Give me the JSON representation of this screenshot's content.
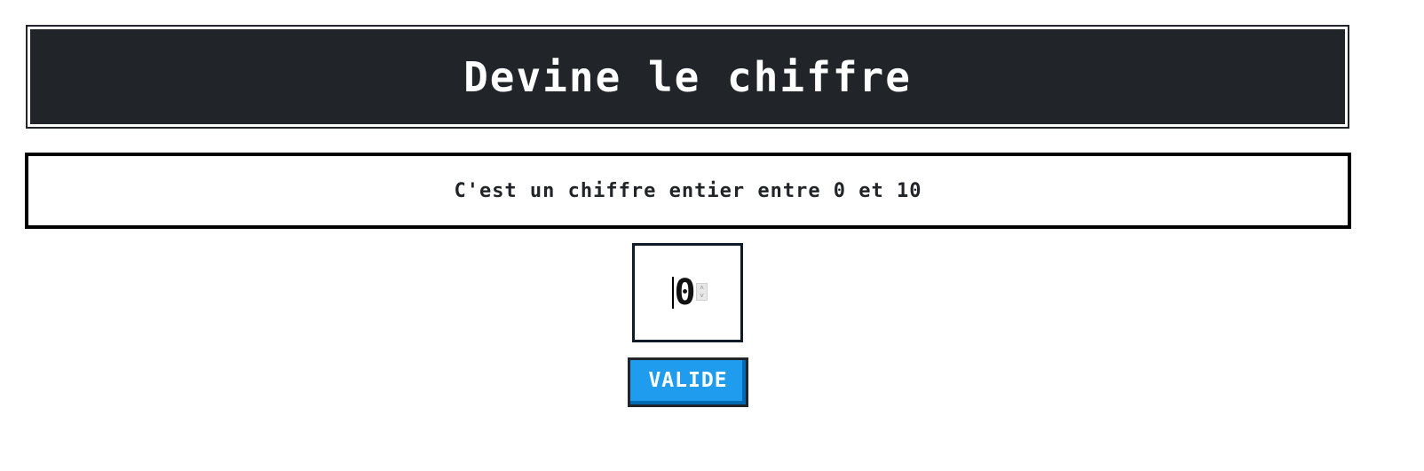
{
  "header": {
    "title": "Devine le chiffre"
  },
  "hint": {
    "text": "C'est un chiffre entier entre 0 et 10"
  },
  "guess_input": {
    "value": "0"
  },
  "submit": {
    "label": "VALIDE"
  },
  "colors": {
    "title_background": "#212529",
    "title_text": "#ffffff",
    "button_background": "#209cee",
    "button_shadow": "#006bb3",
    "border": "#212529"
  },
  "icons": {
    "spinner_up": "chevron-up-icon",
    "spinner_down": "chevron-down-icon"
  }
}
